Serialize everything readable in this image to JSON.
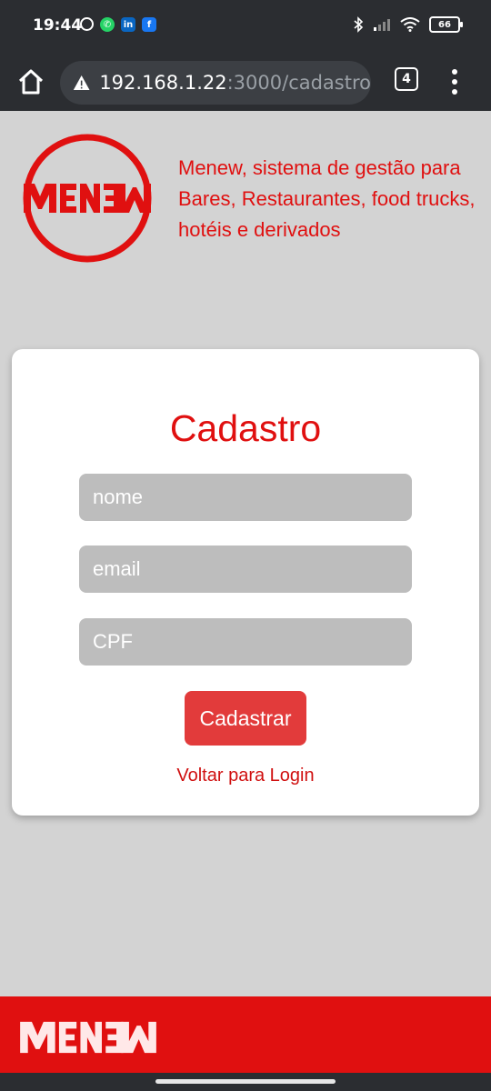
{
  "status_bar": {
    "time": "19:44",
    "battery": "66",
    "icons_left": [
      "alarm-icon",
      "whatsapp-icon",
      "linkedin-icon",
      "facebook-icon"
    ],
    "icons_right": [
      "bluetooth-icon",
      "signal-icon",
      "wifi-icon",
      "battery-icon"
    ]
  },
  "browser": {
    "url_host": "192.168.1.22",
    "url_path": ":3000/cadastro",
    "tab_count": "4"
  },
  "header": {
    "logo_text": "MENEW",
    "tagline": "Menew, sistema de gestão para Bares, Restaurantes, food trucks, hotéis e derivados"
  },
  "form": {
    "title": "Cadastro",
    "name_placeholder": "nome",
    "email_placeholder": "email",
    "cpf_placeholder": "CPF",
    "submit_label": "Cadastrar",
    "back_link": "Voltar para Login"
  },
  "footer": {
    "logo_text": "MENEW"
  },
  "colors": {
    "brand_red": "#e01010",
    "button_red": "#e23b3b",
    "page_bg": "#d3d3d3",
    "field_bg": "#bdbdbd"
  }
}
